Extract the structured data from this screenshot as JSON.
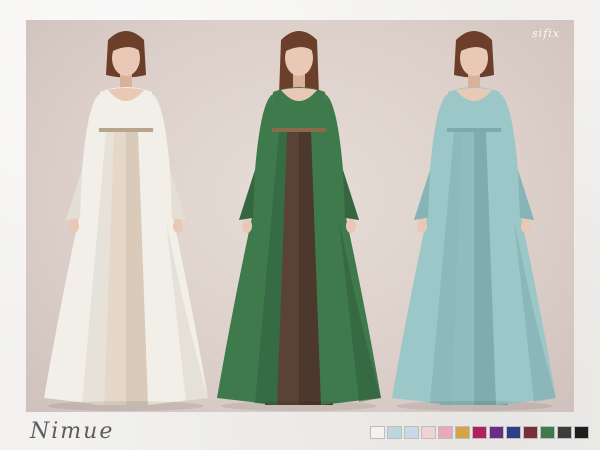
{
  "watermark": "sifix",
  "title": "Nimue",
  "models": [
    {
      "name": "model-white-dress",
      "dress": "#f2efe8",
      "dress_shade": "#d9d3c8",
      "under": "#e6d8c8",
      "under_shade": "#cbbbaa",
      "belt": "#b8a58c"
    },
    {
      "name": "model-green-dress",
      "dress": "#3f7a4d",
      "dress_shade": "#2d5a38",
      "under": "#5a4335",
      "under_shade": "#3e2e25",
      "belt": "#8a6a4a"
    },
    {
      "name": "model-blue-dress",
      "dress": "#9cc7c9",
      "dress_shade": "#79a8ab",
      "under": "#8fbcbf",
      "under_shade": "#6f9c9f",
      "belt": "#7fa9ab"
    }
  ],
  "swatches": [
    {
      "name": "white",
      "color": "#f4f2ee"
    },
    {
      "name": "light-blue",
      "color": "#bcd6dc"
    },
    {
      "name": "pale-blue",
      "color": "#c9d9e6"
    },
    {
      "name": "pale-pink",
      "color": "#eed2d6"
    },
    {
      "name": "pink",
      "color": "#e8a9bf"
    },
    {
      "name": "gold",
      "color": "#d4a447"
    },
    {
      "name": "magenta",
      "color": "#b0215d"
    },
    {
      "name": "purple",
      "color": "#6a2c89"
    },
    {
      "name": "navy",
      "color": "#2d3f8a"
    },
    {
      "name": "burgundy",
      "color": "#7a2d3c"
    },
    {
      "name": "green",
      "color": "#3f7a4d"
    },
    {
      "name": "dark-grey",
      "color": "#3c3c3c"
    },
    {
      "name": "black",
      "color": "#1e1e1e"
    }
  ]
}
